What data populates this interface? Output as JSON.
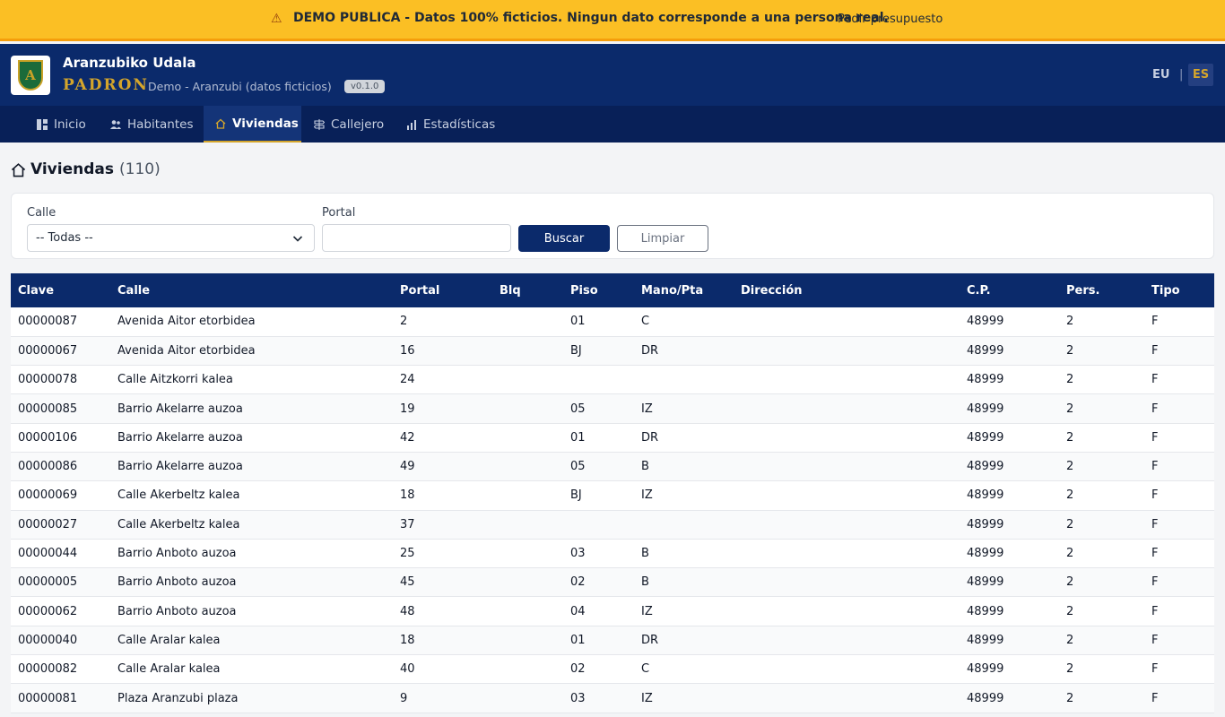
{
  "demo_banner": {
    "message": "DEMO PUBLICA - Datos 100% ficticios. Ningun dato corresponde a una persona real.",
    "link": "Pedir presupuesto"
  },
  "header": {
    "org_name": "Aranzubiko Udala",
    "app_name": "PADRON",
    "subtitle": "Demo - Aranzubi (datos ficticios)",
    "version": "v0.1.0",
    "logo_letter": "A",
    "languages": {
      "eu": "EU",
      "separator": "|",
      "es": "ES"
    }
  },
  "nav": {
    "items": [
      {
        "label": "Inicio",
        "icon": "dashboard-icon"
      },
      {
        "label": "Habitantes",
        "icon": "people-icon"
      },
      {
        "label": "Viviendas",
        "icon": "house-icon"
      },
      {
        "label": "Callejero",
        "icon": "signpost-icon"
      },
      {
        "label": "Estadísticas",
        "icon": "bar-chart-icon"
      }
    ],
    "active": "Viviendas"
  },
  "page": {
    "title": "Viviendas",
    "count": "(110)"
  },
  "filters": {
    "calle_label": "Calle",
    "calle_value": "-- Todas --",
    "portal_label": "Portal",
    "portal_value": "",
    "search_button": "Buscar",
    "clear_button": "Limpiar"
  },
  "table": {
    "columns": [
      "Clave",
      "Calle",
      "Portal",
      "Blq",
      "Piso",
      "Mano/Pta",
      "Dirección",
      "C.P.",
      "Pers.",
      "Tipo"
    ],
    "rows": [
      [
        "00000087",
        "Avenida Aitor etorbidea",
        "2",
        "",
        "01",
        "C",
        "",
        "48999",
        "2",
        "F"
      ],
      [
        "00000067",
        "Avenida Aitor etorbidea",
        "16",
        "",
        "BJ",
        "DR",
        "",
        "48999",
        "2",
        "F"
      ],
      [
        "00000078",
        "Calle Aitzkorri kalea",
        "24",
        "",
        "",
        "",
        "",
        "48999",
        "2",
        "F"
      ],
      [
        "00000085",
        "Barrio Akelarre auzoa",
        "19",
        "",
        "05",
        "IZ",
        "",
        "48999",
        "2",
        "F"
      ],
      [
        "00000106",
        "Barrio Akelarre auzoa",
        "42",
        "",
        "01",
        "DR",
        "",
        "48999",
        "2",
        "F"
      ],
      [
        "00000086",
        "Barrio Akelarre auzoa",
        "49",
        "",
        "05",
        "B",
        "",
        "48999",
        "2",
        "F"
      ],
      [
        "00000069",
        "Calle Akerbeltz kalea",
        "18",
        "",
        "BJ",
        "IZ",
        "",
        "48999",
        "2",
        "F"
      ],
      [
        "00000027",
        "Calle Akerbeltz kalea",
        "37",
        "",
        "",
        "",
        "",
        "48999",
        "2",
        "F"
      ],
      [
        "00000044",
        "Barrio Anboto auzoa",
        "25",
        "",
        "03",
        "B",
        "",
        "48999",
        "2",
        "F"
      ],
      [
        "00000005",
        "Barrio Anboto auzoa",
        "45",
        "",
        "02",
        "B",
        "",
        "48999",
        "2",
        "F"
      ],
      [
        "00000062",
        "Barrio Anboto auzoa",
        "48",
        "",
        "04",
        "IZ",
        "",
        "48999",
        "2",
        "F"
      ],
      [
        "00000040",
        "Calle Aralar kalea",
        "18",
        "",
        "01",
        "DR",
        "",
        "48999",
        "2",
        "F"
      ],
      [
        "00000082",
        "Calle Aralar kalea",
        "40",
        "",
        "02",
        "C",
        "",
        "48999",
        "2",
        "F"
      ],
      [
        "00000081",
        "Plaza Aranzubi plaza",
        "9",
        "",
        "03",
        "IZ",
        "",
        "48999",
        "2",
        "F"
      ]
    ]
  },
  "colors": {
    "banner": "#fbbf24",
    "header": "#0b2a6b",
    "nav": "#082058",
    "accent_gold": "#d4a52b",
    "primary_button": "#0b2a6b"
  }
}
